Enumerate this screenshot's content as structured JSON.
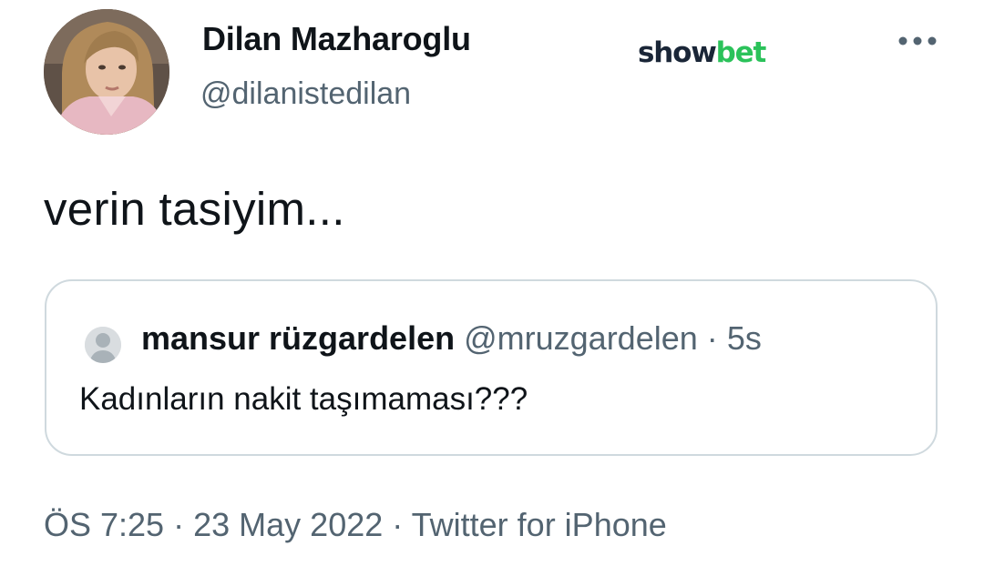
{
  "author": {
    "display_name": "Dilan Mazharoglu",
    "handle": "@dilanistedilan"
  },
  "watermark": {
    "part1": "show",
    "part2": "bet",
    "color1": "#1a2637",
    "color2": "#2bc25a"
  },
  "menu": {
    "icon": "more-horizontal-icon"
  },
  "tweet": {
    "text": "verin tasiyim..."
  },
  "quoted_tweet": {
    "author_name": "mansur rüzgardelen",
    "handle": "@mruzgardelen",
    "separator": "·",
    "time": "5s",
    "text": "Kadınların nakit taşımaması???"
  },
  "meta": {
    "time": "ÖS 7:25",
    "separator1": "·",
    "date": "23 May 2022",
    "separator2": "·",
    "source": "Twitter for iPhone"
  },
  "colors": {
    "text_primary": "#0f1419",
    "text_secondary": "#536471",
    "border": "#cfd9de"
  }
}
